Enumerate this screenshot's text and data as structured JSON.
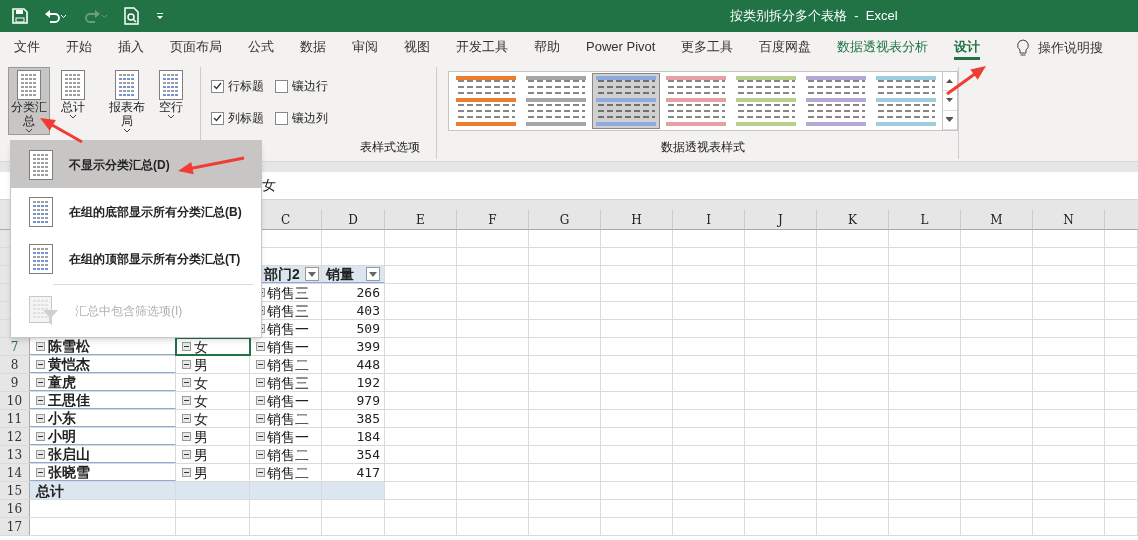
{
  "window": {
    "title": "按类别拆分多个表格  -  Excel"
  },
  "tabs": [
    {
      "label": "文件",
      "selected": false,
      "contextual": false
    },
    {
      "label": "开始",
      "selected": false,
      "contextual": false
    },
    {
      "label": "插入",
      "selected": false,
      "contextual": false
    },
    {
      "label": "页面布局",
      "selected": false,
      "contextual": false
    },
    {
      "label": "公式",
      "selected": false,
      "contextual": false
    },
    {
      "label": "数据",
      "selected": false,
      "contextual": false
    },
    {
      "label": "审阅",
      "selected": false,
      "contextual": false
    },
    {
      "label": "视图",
      "selected": false,
      "contextual": false
    },
    {
      "label": "开发工具",
      "selected": false,
      "contextual": false
    },
    {
      "label": "帮助",
      "selected": false,
      "contextual": false
    },
    {
      "label": "Power Pivot",
      "selected": false,
      "contextual": false
    },
    {
      "label": "更多工具",
      "selected": false,
      "contextual": false
    },
    {
      "label": "百度网盘",
      "selected": false,
      "contextual": false
    },
    {
      "label": "数据透视表分析",
      "selected": false,
      "contextual": true
    },
    {
      "label": "设计",
      "selected": true,
      "contextual": true
    }
  ],
  "tell_me": "操作说明搜",
  "ribbon": {
    "layout_buttons": [
      {
        "label": "分类汇总",
        "selected": true
      },
      {
        "label": "总计",
        "selected": false
      },
      {
        "label": "报表布局",
        "selected": false
      },
      {
        "label": "空行",
        "selected": false
      }
    ],
    "style_options": {
      "label": "表样式选项",
      "checkboxes": [
        {
          "label": "行标题",
          "checked": true
        },
        {
          "label": "镶边行",
          "checked": false
        },
        {
          "label": "列标题",
          "checked": true
        },
        {
          "label": "镶边列",
          "checked": false
        }
      ]
    },
    "styles": {
      "label": "数据透视表样式",
      "items": [
        {
          "color": "#ed7d31",
          "selected": false
        },
        {
          "color": "#a5a5a5",
          "selected": false
        },
        {
          "color": "#8faadc",
          "selected": true
        },
        {
          "color": "#e6a0a6",
          "selected": false
        },
        {
          "color": "#b8d08e",
          "selected": false
        },
        {
          "color": "#b4a7d6",
          "selected": false
        },
        {
          "color": "#9dcfe0",
          "selected": false
        }
      ]
    }
  },
  "subtotal_menu": [
    {
      "label": "不显示分类汇总(D)",
      "selected": true,
      "disabled": false
    },
    {
      "label": "在组的底部显示所有分类汇总(B)",
      "selected": false,
      "disabled": false
    },
    {
      "label": "在组的顶部显示所有分类汇总(T)",
      "selected": false,
      "disabled": false
    },
    {
      "label": "汇总中包含筛选项(I)",
      "selected": false,
      "disabled": true
    }
  ],
  "formula_bar": {
    "value": "女"
  },
  "sheet": {
    "column_headers": [
      "C",
      "D",
      "E",
      "F",
      "G",
      "H",
      "I",
      "J",
      "K",
      "L",
      "M",
      "N"
    ],
    "rows": [
      {
        "kind": "header",
        "dept": "部门2",
        "sales": "销量"
      },
      {
        "kind": "data",
        "dept": "销售三",
        "sales": "266"
      },
      {
        "kind": "data",
        "dept": "销售三",
        "sales": "403"
      },
      {
        "kind": "data",
        "dept": "销售一",
        "sales": "509"
      },
      {
        "kind": "data",
        "number": "7",
        "name": "陈雪松",
        "gender": "女",
        "dept": "销售一",
        "sales": "399",
        "selected": true
      },
      {
        "kind": "data",
        "number": "8",
        "name": "黄恺杰",
        "gender": "男",
        "dept": "销售二",
        "sales": "448",
        "selected": false
      },
      {
        "kind": "data",
        "number": "9",
        "name": "童虎",
        "gender": "女",
        "dept": "销售三",
        "sales": "192",
        "selected": false
      },
      {
        "kind": "data",
        "number": "10",
        "name": "王思佳",
        "gender": "女",
        "dept": "销售一",
        "sales": "979",
        "selected": false
      },
      {
        "kind": "data",
        "number": "11",
        "name": "小东",
        "gender": "女",
        "dept": "销售二",
        "sales": "385",
        "selected": false
      },
      {
        "kind": "data",
        "number": "12",
        "name": "小明",
        "gender": "男",
        "dept": "销售一",
        "sales": "184",
        "selected": false
      },
      {
        "kind": "data",
        "number": "13",
        "name": "张启山",
        "gender": "男",
        "dept": "销售二",
        "sales": "354",
        "selected": false
      },
      {
        "kind": "data",
        "number": "14",
        "name": "张晓雪",
        "gender": "男",
        "dept": "销售二",
        "sales": "417",
        "selected": false
      },
      {
        "kind": "total",
        "number": "15",
        "label": "总计"
      },
      {
        "kind": "blank",
        "number": "16"
      },
      {
        "kind": "blank",
        "number": "17"
      }
    ]
  }
}
